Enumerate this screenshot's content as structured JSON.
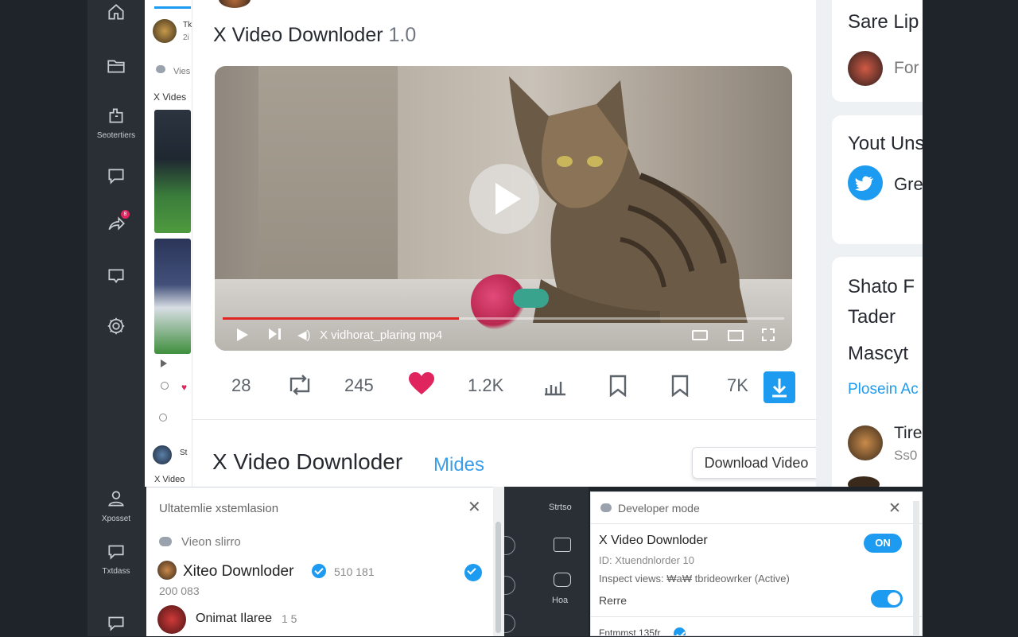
{
  "rail": {
    "items": [
      {
        "icon": "home-icon",
        "label": ""
      },
      {
        "icon": "folder-icon",
        "label": ""
      },
      {
        "icon": "settings-puzzle-icon",
        "label": "Seotertiers"
      },
      {
        "icon": "message-icon",
        "label": ""
      },
      {
        "icon": "share-icon",
        "label": "",
        "badge": "8"
      },
      {
        "icon": "chat-icon",
        "label": ""
      },
      {
        "icon": "gear-icon",
        "label": ""
      }
    ]
  },
  "timeline": {
    "user_short": "Tk",
    "user_sub": "2i",
    "views_label": "Vies",
    "section_label": "X Vides",
    "bottom_label": "X Video",
    "bottom_user": "St"
  },
  "main": {
    "title": "X Video Downloder",
    "version": "1.0",
    "video": {
      "filename": "X vidhorat_plaring mp4",
      "progress_pct": 42
    },
    "actions": {
      "replies": "28",
      "retweets": "245",
      "likes": "1.2K",
      "views": "7K"
    },
    "title2": "X Video Downloder",
    "title2_link": "Mides",
    "download_button": "Download Video"
  },
  "right": {
    "card1_title": "Sare Lip",
    "card1_sub": "For",
    "card2_title": "Yout Uns",
    "card2_sub": "Gre",
    "card3_title": "Shato F",
    "card3_line2": "Tader",
    "card3_line3": "Mascyt",
    "card3_link": "Plosein Ac",
    "card3_user": "Tire",
    "card3_user_sub": "Ss0"
  },
  "bottom_left": {
    "rail_label1": "Xposset",
    "rail_label2": "Txtdass",
    "header": "Ultatemlie xstemlasion",
    "sub_header": "Vieon slirro",
    "account_name": "Xiteo Downloder",
    "account_meta": "510 181",
    "account_count": "200  083",
    "item2": "Onimat Ilaree",
    "item2_meta": "1 5"
  },
  "bottom_mid_rail": {
    "label1": "Strtso",
    "label2": "Hoa"
  },
  "developer": {
    "header": "Developer mode",
    "ext_name": "X Video Downloder",
    "ext_id": "ID: Xtuendnlorder 10",
    "toggle_label": "ON",
    "inspect": "Inspect views: ₩a₩ tbrideowrker (Active)",
    "remove": "Rerre",
    "footer": "Fntmmst 135fr"
  },
  "colors": {
    "accent": "#1d9bf0",
    "like": "#e0245e",
    "dark_rail": "#2a2f36"
  }
}
